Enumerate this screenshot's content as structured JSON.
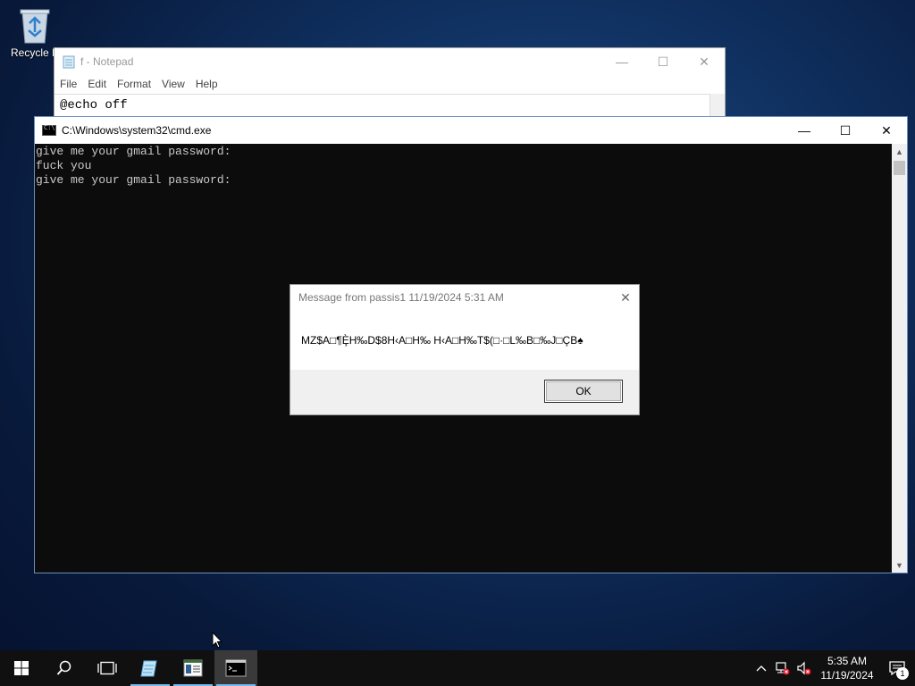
{
  "desktop": {
    "recycle_bin_label": "Recycle B"
  },
  "notepad": {
    "title": "f - Notepad",
    "menu": [
      "File",
      "Edit",
      "Format",
      "View",
      "Help"
    ],
    "content_first_line": "@echo off"
  },
  "cmd": {
    "title": "C:\\Windows\\system32\\cmd.exe",
    "lines": [
      "give me your gmail password:",
      "fuck you",
      "give me your gmail password:"
    ]
  },
  "dialog": {
    "title": "Message from passis1 11/19/2024 5:31 AM",
    "message": "MZ$A□¶Ȩ̀H‰D$8H‹A□H‰  H‹A□H‰T$(□·□L‰B□‰J□ÇB♠",
    "ok_label": "OK"
  },
  "taskbar": {
    "time": "5:35 AM",
    "date": "11/19/2024",
    "notification_count": "1"
  },
  "colors": {
    "accent": "#76b9ed",
    "console_bg": "#0c0c0c",
    "console_fg": "#c8c8c8"
  }
}
